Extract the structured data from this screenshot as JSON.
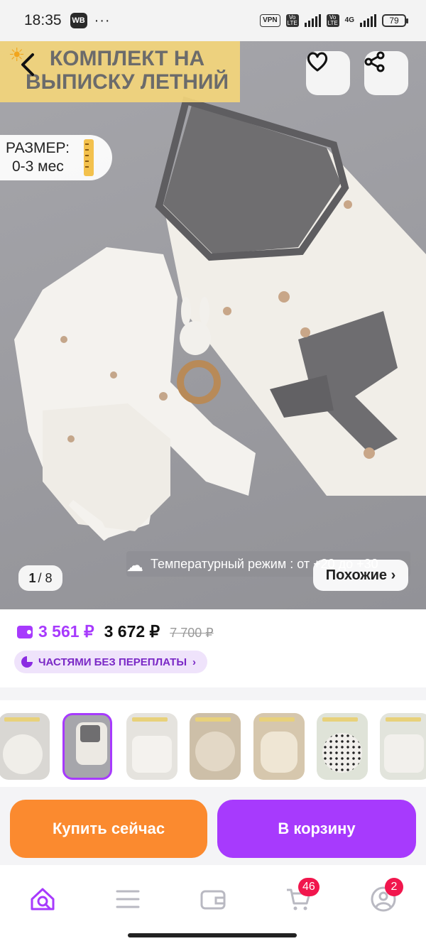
{
  "status_bar": {
    "time": "18:35",
    "app_icon": "WB",
    "more": "···",
    "vpn": "VPN",
    "volte1": "Vo LTE",
    "volte2": "Vo LTE",
    "net": "4G",
    "battery": "79"
  },
  "hero": {
    "title": "КОМПЛЕКТ НА ВЫПИСКУ ЛЕТНИЙ",
    "size_label": "РАЗМЕР:",
    "size_value": "0-3 мес",
    "temperature": "Температурный режим : от +20 до +30",
    "counter_current": "1",
    "counter_total": "/ 8",
    "similar_label": "Похожие ›",
    "icons": {
      "back": "chevron-left",
      "favorite": "heart",
      "share": "share"
    }
  },
  "price": {
    "card_price": "3 561 ₽",
    "price": "3 672 ₽",
    "old_price": "7 700 ₽",
    "installment_label": "ЧАСТЯМИ БЕЗ ПЕРЕПЛАТЫ",
    "installment_arrow": "›"
  },
  "thumbnails": {
    "count": 7,
    "active_index": 1
  },
  "actions": {
    "buy_now": "Купить сейчас",
    "add_to_cart": "В корзину"
  },
  "bottom_nav": {
    "cart_badge": "46",
    "profile_badge": "2"
  },
  "colors": {
    "accent": "#a73afd",
    "buy_button": "#fb8a2f",
    "badge": "#f1164d"
  }
}
